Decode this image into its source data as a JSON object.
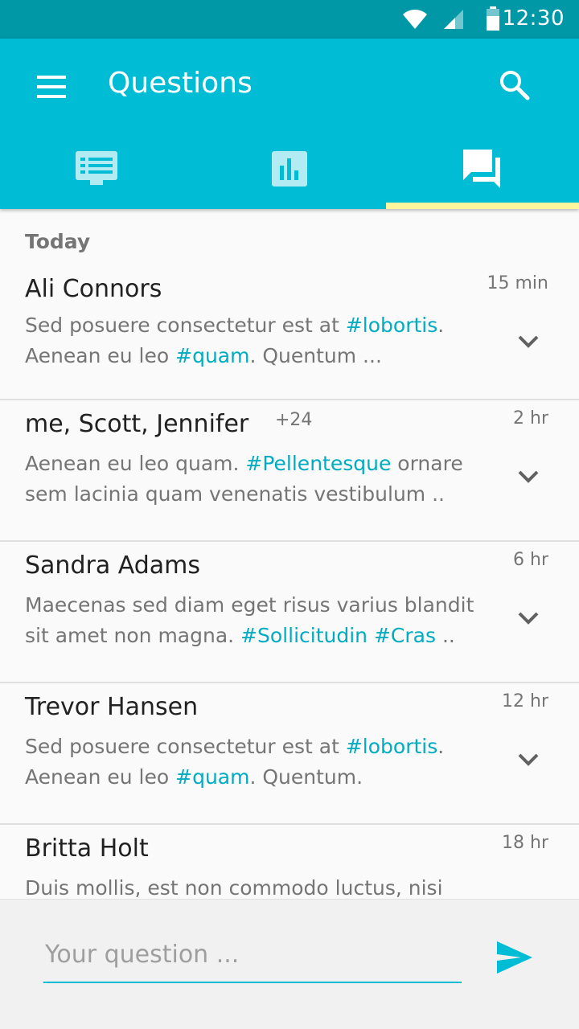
{
  "status_bar": {
    "time": "12:30"
  },
  "app_bar": {
    "title": "Questions",
    "menu_icon": "menu-icon",
    "search_icon": "search-icon",
    "color": "#00bcd4"
  },
  "tabs": [
    {
      "icon": "feed-list-icon",
      "active": false
    },
    {
      "icon": "bar-chart-icon",
      "active": false
    },
    {
      "icon": "forum-icon",
      "active": true
    }
  ],
  "section_header": "Today",
  "items": [
    {
      "name": "Ali Connors",
      "extra": "",
      "time": "15 min",
      "line1": [
        {
          "t": "Sed posuere consectetur est at "
        },
        {
          "t": "#lobortis",
          "tag": true
        },
        {
          "t": "."
        }
      ],
      "line2": [
        {
          "t": "Aenean eu leo "
        },
        {
          "t": "#quam",
          "tag": true
        },
        {
          "t": ". Quentum ..."
        }
      ]
    },
    {
      "name": "me, Scott, Jennifer",
      "extra": "+24",
      "time": "2 hr",
      "line1": [
        {
          "t": "Aenean eu leo quam. "
        },
        {
          "t": "#Pellentesque",
          "tag": true
        },
        {
          "t": " ornare"
        }
      ],
      "line2": [
        {
          "t": "sem lacinia quam venenatis vestibulum .."
        }
      ]
    },
    {
      "name": "Sandra Adams",
      "extra": "",
      "time": "6 hr",
      "line1": [
        {
          "t": "Maecenas sed diam eget risus varius blandit"
        }
      ],
      "line2": [
        {
          "t": "sit amet non magna. "
        },
        {
          "t": "#Sollicitudin",
          "tag": true
        },
        {
          "t": " "
        },
        {
          "t": "#Cras",
          "tag": true
        },
        {
          "t": " .."
        }
      ]
    },
    {
      "name": "Trevor Hansen",
      "extra": "",
      "time": "12 hr",
      "line1": [
        {
          "t": "Sed posuere consectetur est at "
        },
        {
          "t": "#lobortis",
          "tag": true
        },
        {
          "t": "."
        }
      ],
      "line2": [
        {
          "t": "Aenean eu leo "
        },
        {
          "t": "#quam",
          "tag": true
        },
        {
          "t": ". Quentum."
        }
      ]
    },
    {
      "name": "Britta Holt",
      "extra": "",
      "time": "18 hr",
      "line1": [
        {
          "t": "Duis mollis, est non commodo luctus, nisi"
        }
      ],
      "line2": [
        {
          "t": ""
        }
      ]
    }
  ],
  "composer": {
    "placeholder": "Your question ...",
    "send_icon": "send-icon"
  },
  "colors": {
    "primary": "#00bcd4",
    "primary_dark": "#0097a7",
    "tab_indicator": "#fff59d",
    "hashtag": "#00acc1"
  }
}
